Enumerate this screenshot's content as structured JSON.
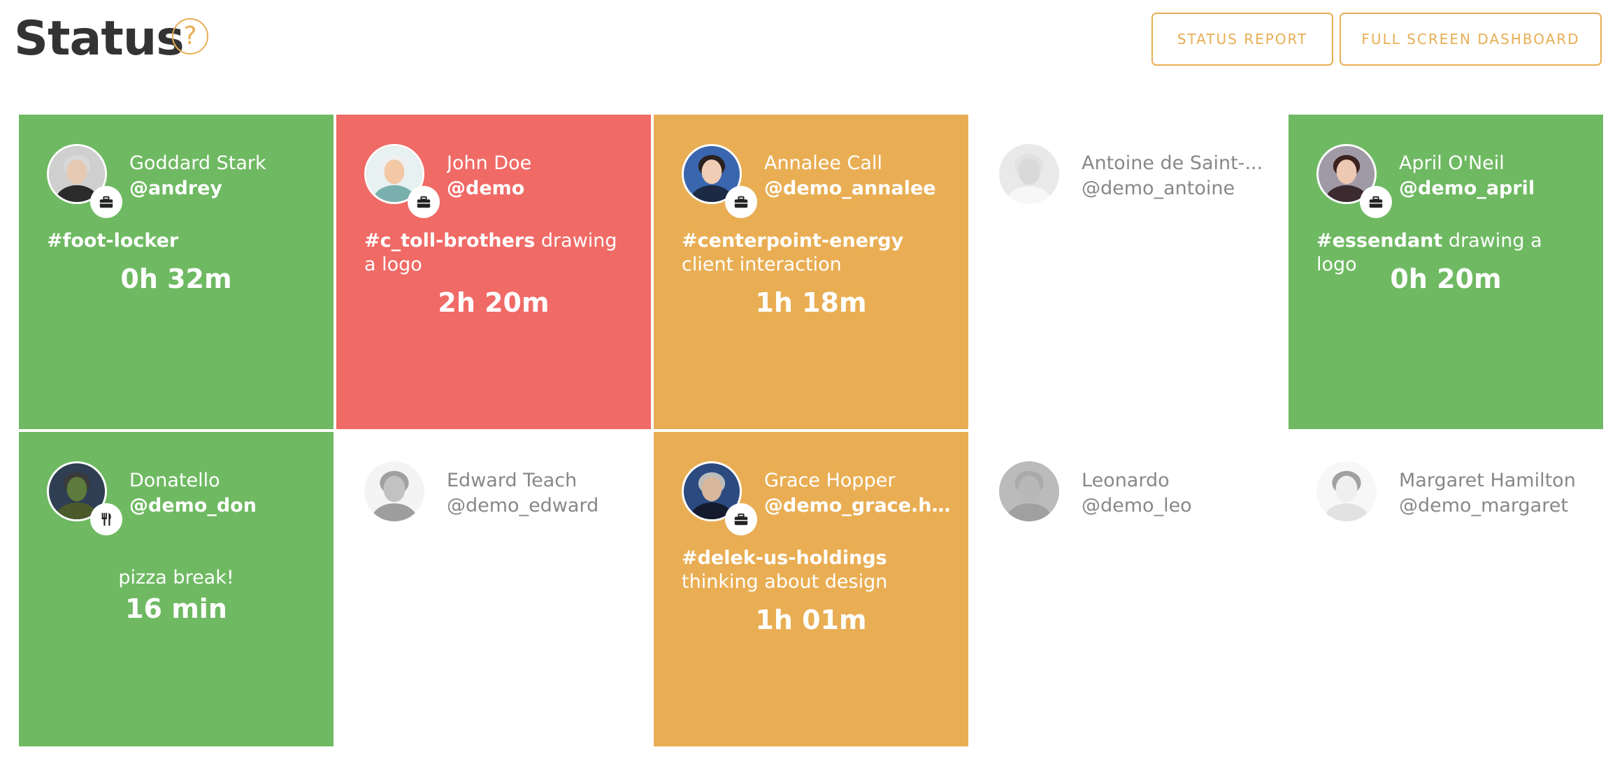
{
  "page": {
    "title": "Status",
    "help_glyph": "?"
  },
  "actions": {
    "status_report": "STATUS REPORT",
    "full_screen_dashboard": "FULL SCREEN DASHBOARD"
  },
  "colors": {
    "green": "#6fb962",
    "red": "#f06a66",
    "orange": "#e9ae54",
    "accent": "#e8ae55"
  },
  "tiles": [
    {
      "status": "green",
      "name": "Goddard Stark",
      "handle": "@andrey",
      "tag": "#foot-locker",
      "note": "",
      "timer": "0h 32m",
      "badge_icon": "briefcase-icon",
      "avatar_icon": "man-suit-icon"
    },
    {
      "status": "red",
      "name": "John Doe",
      "handle": "@demo",
      "tag": "#c_toll-brothers",
      "note": " drawing a logo",
      "timer": "2h 20m",
      "badge_icon": "briefcase-icon",
      "avatar_icon": "bald-man-icon"
    },
    {
      "status": "orange",
      "name": "Annalee Call",
      "handle": "@demo_annalee",
      "tag": "#centerpoint-energy",
      "note": " client interaction",
      "timer": "1h 18m",
      "badge_icon": "briefcase-icon",
      "avatar_icon": "woman-dark-hair-icon"
    },
    {
      "status": "offline",
      "name": "Antoine de Saint-...",
      "handle": "@demo_antoine",
      "avatar_icon": "man-bald-tie-icon"
    },
    {
      "status": "green",
      "name": "April O'Neil",
      "handle": "@demo_april",
      "tag": "#essendant",
      "note": " drawing a logo",
      "timer": "0h 20m",
      "badge_icon": "briefcase-icon",
      "avatar_icon": "woman-long-hair-icon"
    },
    {
      "status": "green",
      "name": "Donatello",
      "handle": "@demo_don",
      "message": "pizza break!",
      "timer": "16 min",
      "badge_icon": "fork-knife-icon",
      "avatar_icon": "turtle-icon"
    },
    {
      "status": "offline",
      "name": "Edward Teach",
      "handle": "@demo_edward",
      "avatar_icon": "pirate-icon"
    },
    {
      "status": "orange",
      "name": "Grace Hopper",
      "handle": "@demo_grace.ho...",
      "tag": "#delek-us-holdings",
      "note": " thinking about design",
      "timer": "1h 01m",
      "badge_icon": "briefcase-icon",
      "avatar_icon": "woman-uniform-icon"
    },
    {
      "status": "offline",
      "name": "Leonardo",
      "handle": "@demo_leo",
      "avatar_icon": "turtle-mask-icon"
    },
    {
      "status": "offline",
      "name": "Margaret Hamilton",
      "handle": "@demo_margaret",
      "avatar_icon": "woman-sketch-icon"
    }
  ]
}
